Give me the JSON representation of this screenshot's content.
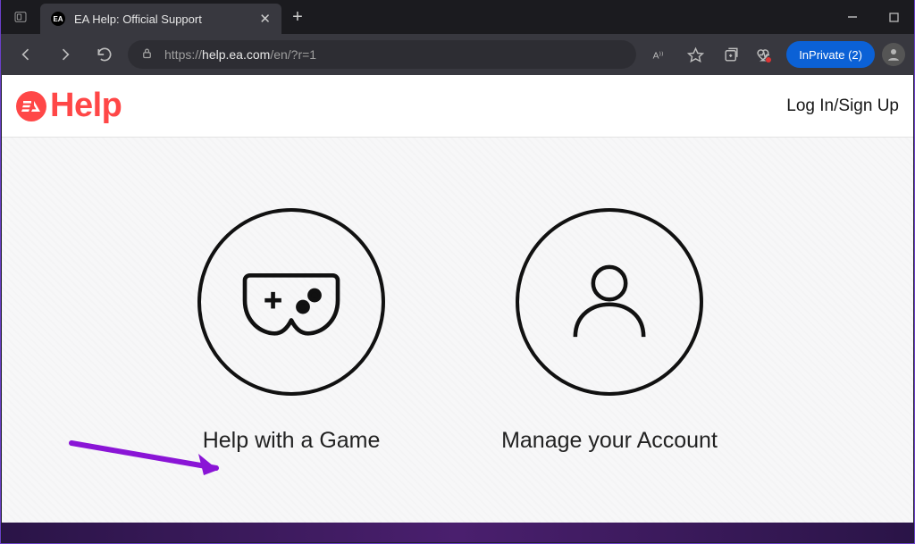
{
  "browser": {
    "tab_title": "EA Help: Official Support",
    "favicon_text": "EA",
    "url_prefix": "https://",
    "url_host": "help.ea.com",
    "url_path": "/en/?r=1",
    "inprivate_label": "InPrivate (2)"
  },
  "header": {
    "logo_text": "EA",
    "brand_word": "Help",
    "login_label": "Log In/Sign Up"
  },
  "options": {
    "game": {
      "label": "Help with a Game"
    },
    "account": {
      "label": "Manage your Account"
    }
  }
}
